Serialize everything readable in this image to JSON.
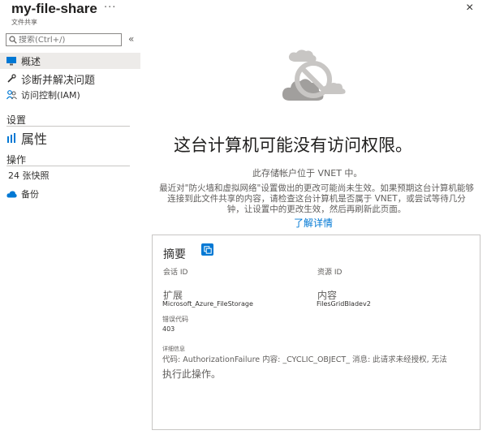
{
  "header": {
    "title": "my-file-share",
    "more_icon": "···",
    "subtitle": "文件共享",
    "close_icon": "×"
  },
  "sidebar": {
    "search_placeholder": "搜索(Ctrl+/)",
    "collapse_icon": "«",
    "items": [
      {
        "label": "概述",
        "icon": "overview-icon"
      },
      {
        "label": "诊断并解决问题",
        "icon": "wrench-icon"
      },
      {
        "label": "访问控制(IAM)",
        "icon": "people-icon"
      }
    ],
    "sections": [
      {
        "title": "设置",
        "items": [
          {
            "label": "属性",
            "icon": "properties-icon"
          }
        ]
      },
      {
        "title": "操作",
        "items": [
          {
            "label": "24 张快照"
          },
          {
            "label": "备份",
            "icon": "cloud-icon"
          }
        ]
      }
    ]
  },
  "main": {
    "heading": "这台计算机可能没有访问权限。",
    "sub": "此存储帐户位于 VNET 中。",
    "description": "最近对\"防火墙和虚拟网络\"设置做出的更改可能尚未生效。如果预期这台计算机能够连接到此文件共享的内容，请检查这台计算机是否属于 VNET，或尝试等待几分钟，让设置中的更改生效，然后再刷新此页面。",
    "learn_more": "了解详情"
  },
  "summary": {
    "title": "摘要",
    "session_id_label": "会话 ID",
    "resource_id_label": "资源 ID",
    "extension_label": "扩展",
    "extension_value": "Microsoft_Azure_FileStorage",
    "content_label": "内容",
    "content_value": "FilesGridBladev2",
    "error_code_label": "错误代码",
    "error_code_value": "403",
    "details_label": "详细信息",
    "details_value": "代码: AuthorizationFailure 内容: _CYCLIC_OBJECT_ 消息: 此请求未经授权, 无法",
    "details_value2": "执行此操作。"
  },
  "colors": {
    "accent": "#0078d4",
    "selected": "#edebe9"
  }
}
